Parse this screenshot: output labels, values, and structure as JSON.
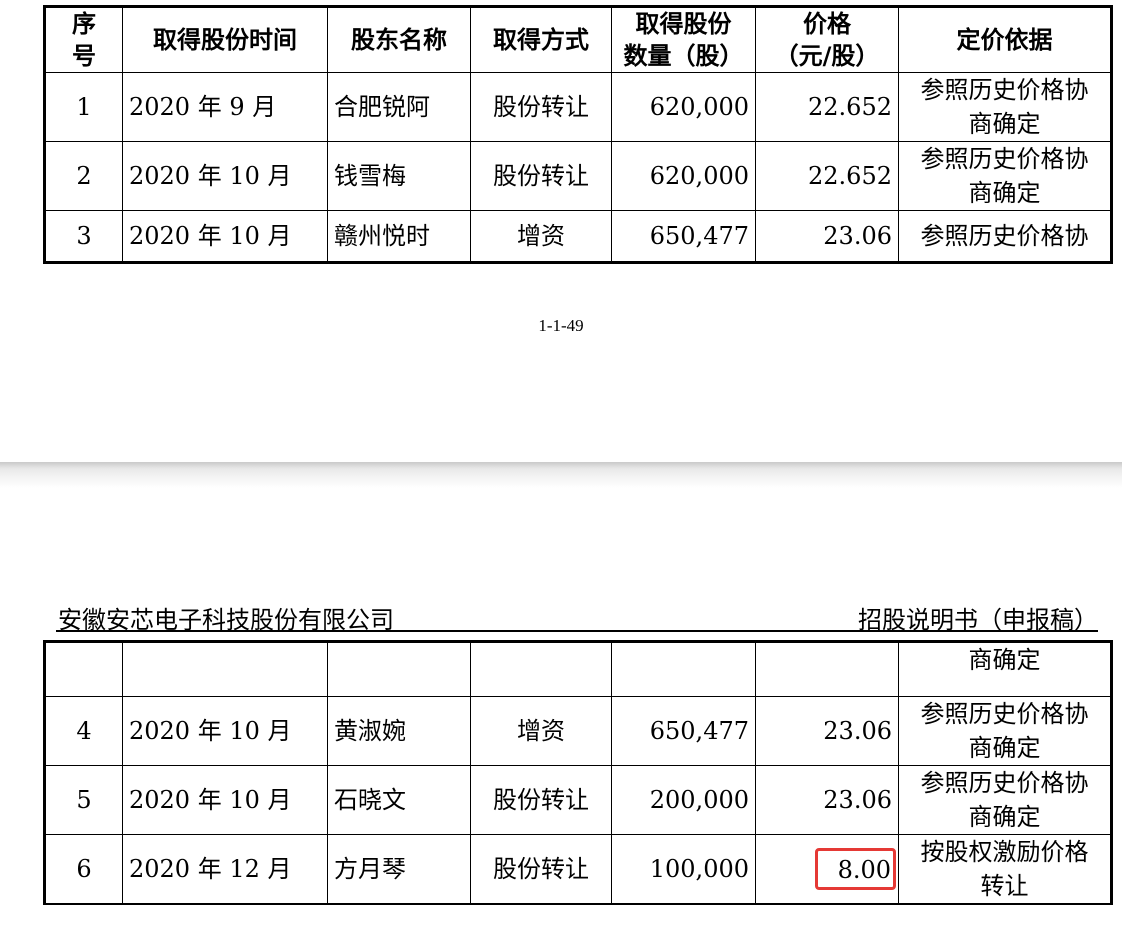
{
  "columns": {
    "seq": [
      "序",
      "号"
    ],
    "time": "取得股份时间",
    "name": "股东名称",
    "method": "取得方式",
    "qty": [
      "取得股份",
      "数量（股）"
    ],
    "price": [
      "价格",
      "（元/股）"
    ],
    "basis": "定价依据"
  },
  "rows_top": [
    {
      "seq": "1",
      "time": "2020 年 9 月",
      "name": "合肥锐阿",
      "method": "股份转让",
      "qty": "620,000",
      "price": "22.652",
      "basis": [
        "参照历史价格协",
        "商确定"
      ]
    },
    {
      "seq": "2",
      "time": "2020 年 10 月",
      "name": "钱雪梅",
      "method": "股份转让",
      "qty": "620,000",
      "price": "22.652",
      "basis": [
        "参照历史价格协",
        "商确定"
      ]
    },
    {
      "seq": "3",
      "time": "2020 年 10 月",
      "name": "赣州悦时",
      "method": "增资",
      "qty": "650,477",
      "price": "23.06",
      "basis": [
        "参照历史价格协"
      ]
    }
  ],
  "page_number": "1-1-49",
  "header": {
    "company": "安徽安芯电子科技股份有限公司",
    "doc_type": "招股说明书（申报稿）"
  },
  "rows_bottom": [
    {
      "seq": "",
      "time": "",
      "name": "",
      "method": "",
      "qty": "",
      "price": "",
      "basis": [
        "商确定"
      ]
    },
    {
      "seq": "4",
      "time": "2020 年 10 月",
      "name": "黄淑婉",
      "method": "增资",
      "qty": "650,477",
      "price": "23.06",
      "basis": [
        "参照历史价格协",
        "商确定"
      ]
    },
    {
      "seq": "5",
      "time": "2020 年 10 月",
      "name": "石晓文",
      "method": "股份转让",
      "qty": "200,000",
      "price": "23.06",
      "basis": [
        "参照历史价格协",
        "商确定"
      ]
    },
    {
      "seq": "6",
      "time": "2020 年 12 月",
      "name": "方月琴",
      "method": "股份转让",
      "qty": "100,000",
      "price": "8.00",
      "basis": [
        "按股权激励价格",
        "转让"
      ]
    }
  ],
  "highlight_color": "#e53935"
}
